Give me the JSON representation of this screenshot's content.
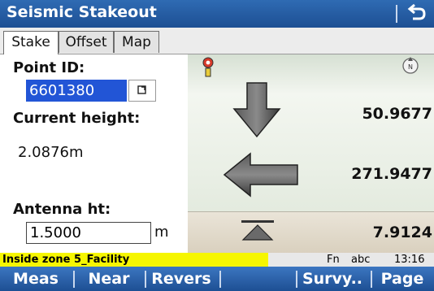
{
  "app": {
    "title": "Seismic Stakeout"
  },
  "tabs": [
    {
      "label": "Stake",
      "active": true
    },
    {
      "label": "Offset",
      "active": false
    },
    {
      "label": "Map",
      "active": false
    }
  ],
  "form": {
    "point_id_label": "Point ID:",
    "point_id_value": "6601380",
    "current_height_label": "Current height:",
    "current_height_value": "2.0876m",
    "antenna_label": "Antenna ht:",
    "antenna_value": "1.5000",
    "antenna_unit": "m"
  },
  "navigation": {
    "down_value": "50.9677",
    "left_value": "271.9477",
    "up_value": "7.9124"
  },
  "status_bar": {
    "message": "Inside zone 5_Facility",
    "fn": "Fn",
    "input_mode": "abc",
    "time": "13:16"
  },
  "softkeys": [
    {
      "label": "Meas"
    },
    {
      "label": "Near"
    },
    {
      "label": "Revers"
    },
    {
      "label": ""
    },
    {
      "label": "Survy.."
    },
    {
      "label": "Page"
    }
  ],
  "colors": {
    "title_bar": "#2f6bb3",
    "softkey_bar": "#1d4f93",
    "status_highlight": "#f6f600",
    "input_selected": "#2255d6"
  }
}
